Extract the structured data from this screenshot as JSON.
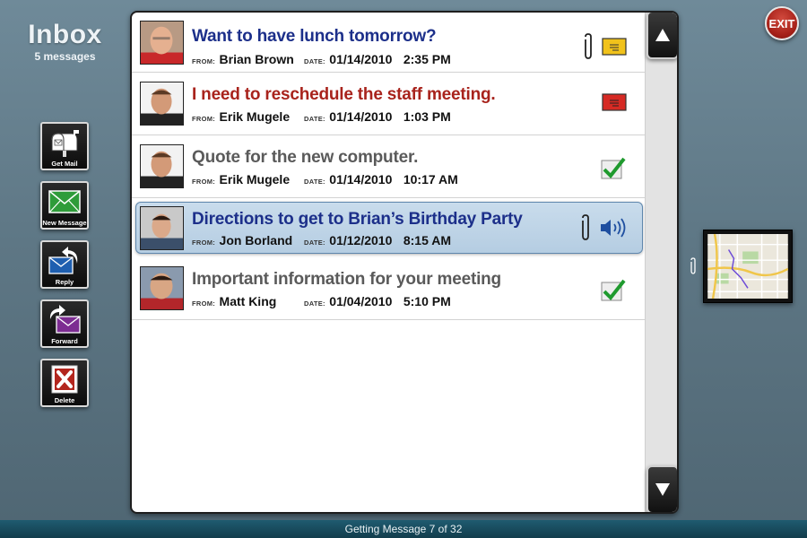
{
  "header": {
    "title": "Inbox",
    "count": "5 messages"
  },
  "toolbar": {
    "get_mail": "Get Mail",
    "new_message": "New Message",
    "reply": "Reply",
    "forward": "Forward",
    "delete": "Delete"
  },
  "labels": {
    "from": "FROM:",
    "date": "DATE:"
  },
  "messages": [
    {
      "subject": "Want to have lunch tomorrow?",
      "from": "Brian Brown",
      "date": "01/14/2010",
      "time": "2:35 PM",
      "subject_color": "#1c2f8a",
      "icons": [
        "paperclip-icon",
        "envelope-yellow-icon"
      ]
    },
    {
      "subject": "I need to reschedule the staff meeting.",
      "from": "Erik Mugele",
      "date": "01/14/2010",
      "time": "1:03 PM",
      "subject_color": "#a8231c",
      "icons": [
        "envelope-red-icon"
      ]
    },
    {
      "subject": "Quote for the new computer.",
      "from": "Erik Mugele",
      "date": "01/14/2010",
      "time": "10:17 AM",
      "subject_color": "#5a5a5a",
      "icons": [
        "checkmark-icon"
      ]
    },
    {
      "subject": "Directions to get to Brian’s Birthday Party",
      "from": "Jon Borland",
      "date": "01/12/2010",
      "time": "8:15 AM",
      "subject_color": "#1c2f8a",
      "selected": true,
      "icons": [
        "paperclip-icon",
        "speaker-icon"
      ]
    },
    {
      "subject": "Important information for your meeting",
      "from": "Matt King",
      "date": "01/04/2010",
      "time": "5:10 PM",
      "subject_color": "#5a5a5a",
      "icons": [
        "checkmark-icon"
      ]
    }
  ],
  "exit_label": "EXIT",
  "status": "Getting Message 7 of 32"
}
